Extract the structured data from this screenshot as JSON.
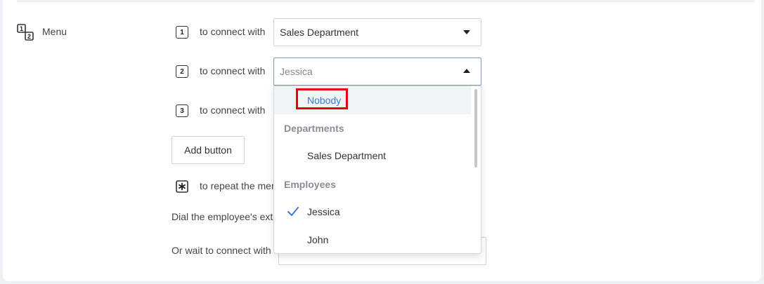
{
  "menu": {
    "label": "Menu",
    "icon": "keypad-icon"
  },
  "rows": [
    {
      "key": "1",
      "connect_text": "to connect with",
      "selected": "Sales Department"
    },
    {
      "key": "2",
      "connect_text": "to connect with",
      "placeholder": "Jessica"
    },
    {
      "key": "3",
      "connect_text": "to connect with"
    }
  ],
  "add_button": "Add button",
  "repeat": {
    "key": "asterisk-icon",
    "text": "to repeat the menu"
  },
  "dial_text": "Dial the employee's extension",
  "wait_text": "Or wait to connect with",
  "dropdown": {
    "nobody": "Nobody",
    "groups": [
      {
        "header": "Departments",
        "items": [
          "Sales Department"
        ]
      },
      {
        "header": "Employees",
        "items": [
          "Jessica",
          "John"
        ]
      }
    ],
    "checked": "Jessica",
    "highlight_color": "#e3000f",
    "accent_color": "#3d7ad6"
  }
}
